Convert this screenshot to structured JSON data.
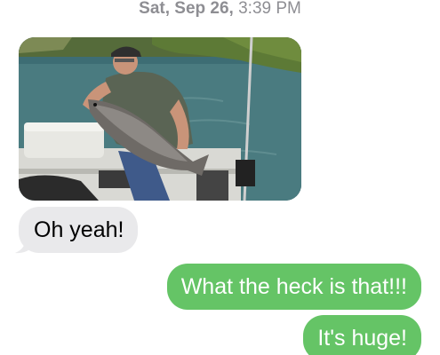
{
  "thread": {
    "timestamp_day": "Sat, Sep 26,",
    "timestamp_time": "3:39 PM"
  },
  "messages": [
    {
      "direction": "incoming",
      "type": "photo",
      "photo_description": "fisherman-holding-salmon"
    },
    {
      "direction": "incoming",
      "type": "text",
      "text": "Oh yeah!"
    },
    {
      "direction": "outgoing",
      "type": "text",
      "text": "What the heck is that!!!"
    },
    {
      "direction": "outgoing",
      "type": "text",
      "text": "It's huge!"
    }
  ],
  "colors": {
    "incoming_bubble": "#e9e9eb",
    "outgoing_bubble": "#65c466",
    "timestamp": "#8e8e93"
  }
}
